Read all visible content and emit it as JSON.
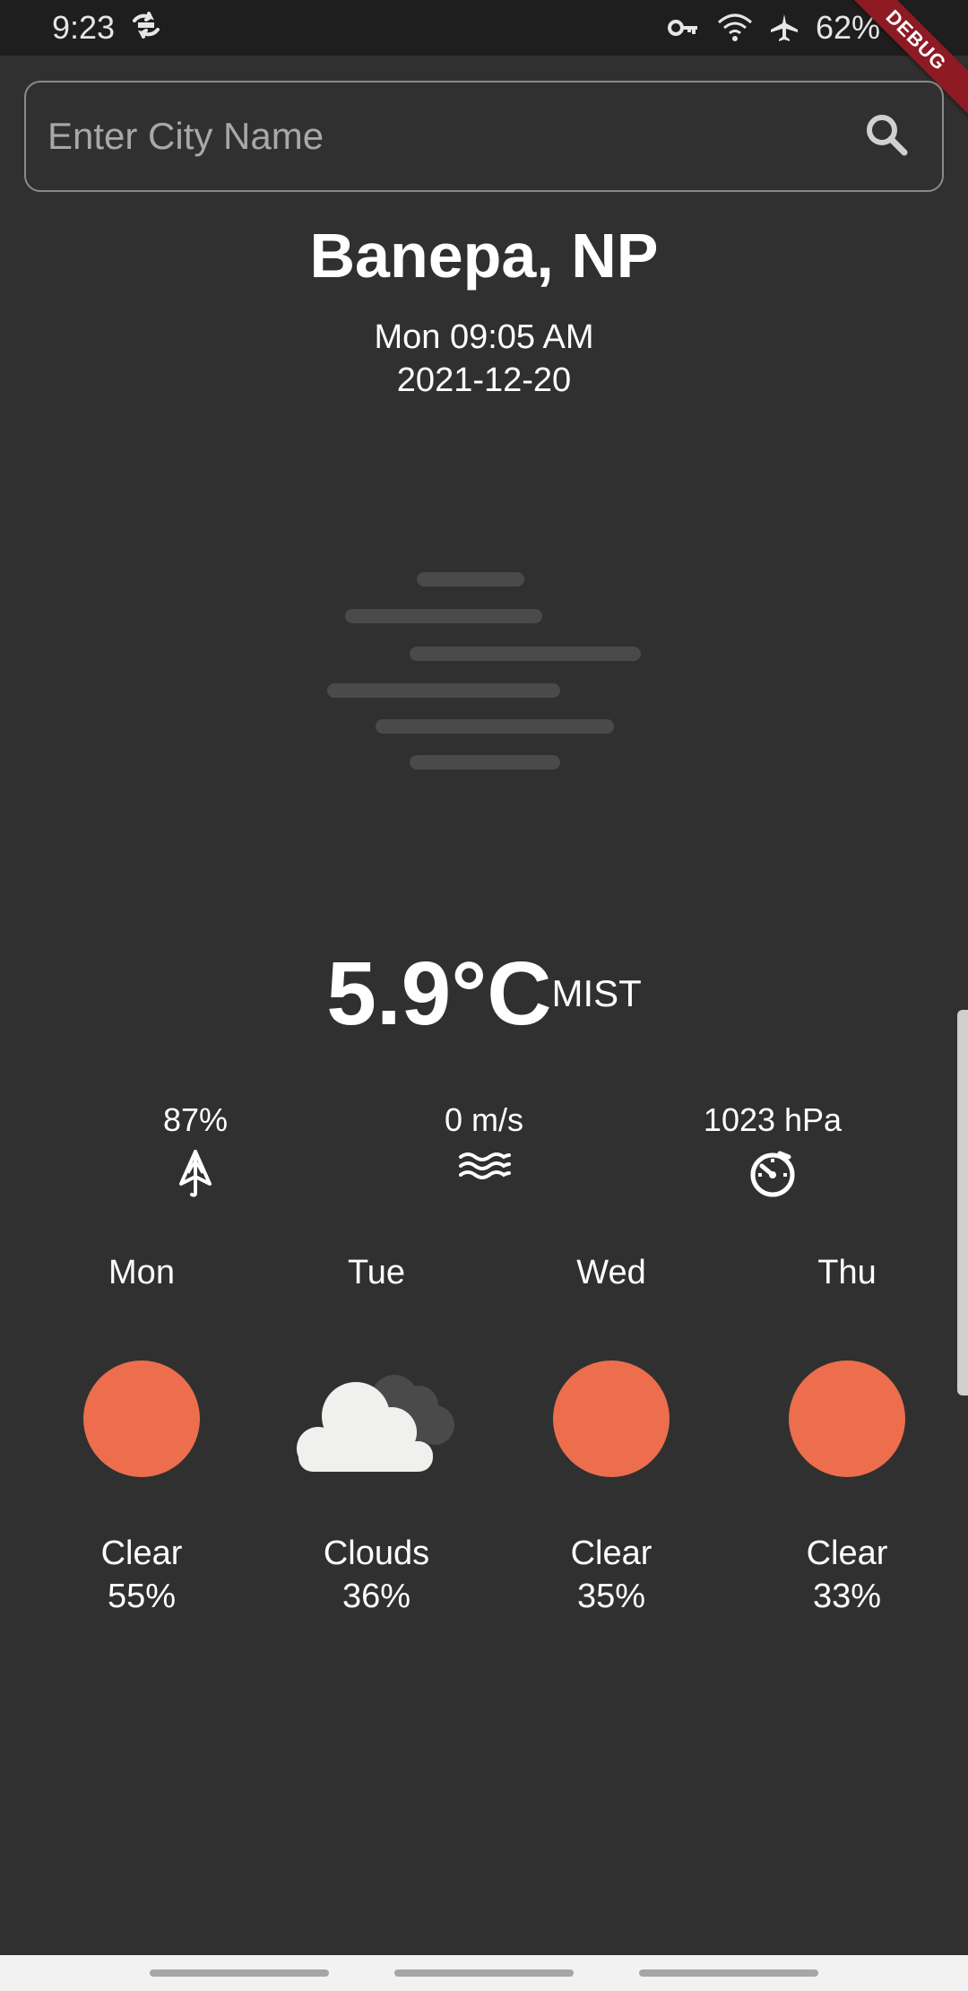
{
  "status_bar": {
    "time": "9:23",
    "battery": "62%",
    "icons": [
      "sync-icon",
      "vpn-key-icon",
      "wifi-icon",
      "airplane-icon",
      "battery-icon"
    ]
  },
  "debug_banner": "DEBUG",
  "search": {
    "placeholder": "Enter City Name",
    "value": "",
    "icon": "search-icon"
  },
  "location": {
    "city": "Banepa, NP",
    "day_time": "Mon 09:05 AM",
    "date": "2021-12-20"
  },
  "current": {
    "icon": "mist-icon",
    "temperature": "5.9°C",
    "condition": "MIST"
  },
  "stats": [
    {
      "value": "87%",
      "icon": "umbrella-icon"
    },
    {
      "value": "0 m/s",
      "icon": "wind-waves-icon"
    },
    {
      "value": "1023 hPa",
      "icon": "pressure-gauge-icon"
    }
  ],
  "forecast": [
    {
      "day": "Mon",
      "icon": "sun-icon",
      "condition": "Clear",
      "percent": "55%"
    },
    {
      "day": "Tue",
      "icon": "clouds-icon",
      "condition": "Clouds",
      "percent": "36%"
    },
    {
      "day": "Wed",
      "icon": "sun-icon",
      "condition": "Clear",
      "percent": "35%"
    },
    {
      "day": "Thu",
      "icon": "sun-icon",
      "condition": "Clear",
      "percent": "33%"
    }
  ],
  "colors": {
    "background": "#303030",
    "status_bar": "#1e1e1e",
    "sun": "#ec6e4c",
    "mist": "#4a4a4a",
    "debug_ribbon": "#8e1b24"
  }
}
